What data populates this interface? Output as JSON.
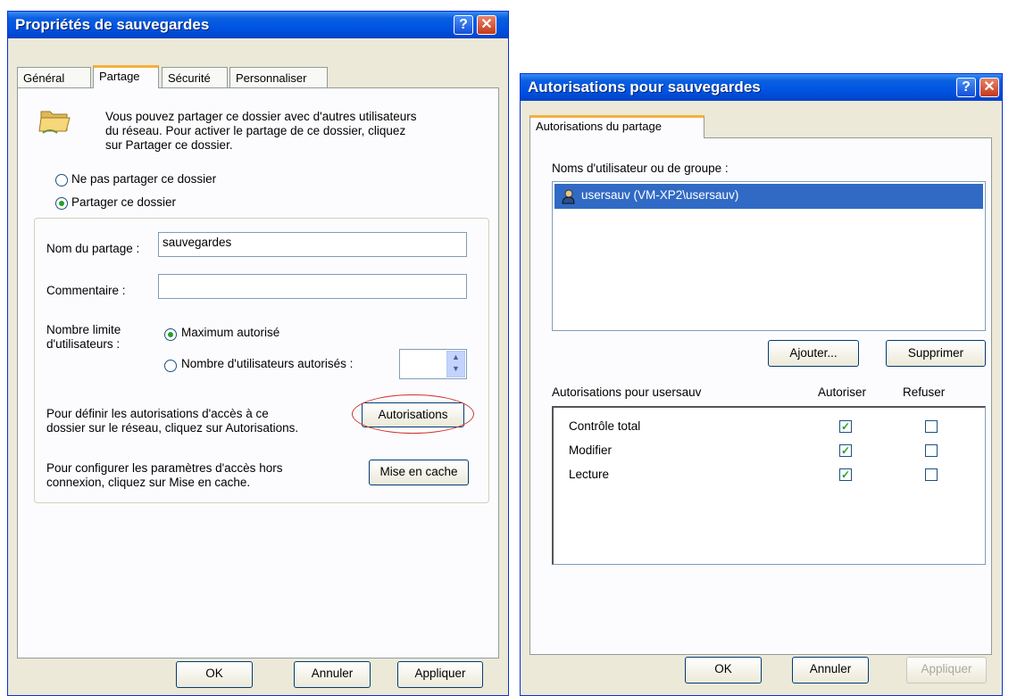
{
  "left_dialog": {
    "title": "Propriétés de sauvegardes",
    "help_glyph": "?",
    "close_glyph": "✕",
    "tabs": [
      "Général",
      "Partage",
      "Sécurité",
      "Personnaliser"
    ],
    "active_tab": "Partage",
    "intro": [
      "Vous pouvez partager ce dossier avec d'autres utilisateurs",
      "du réseau. Pour activer le partage de ce dossier, cliquez",
      "sur Partager ce dossier."
    ],
    "radio_no_share": "Ne pas partager ce dossier",
    "radio_share": "Partager ce dossier",
    "share_name_label": "Nom du partage :",
    "share_name_value": "sauvegardes",
    "comment_label": "Commentaire :",
    "comment_value": "",
    "user_limit_label": [
      "Nombre limite",
      "d'utilisateurs :"
    ],
    "radio_max": "Maximum autorisé",
    "radio_count": "Nombre d'utilisateurs autorisés :",
    "spin_value": "",
    "permissions_text": [
      "Pour définir les autorisations d'accès à ce",
      "dossier sur le réseau, cliquez sur Autorisations."
    ],
    "permissions_button": "Autorisations",
    "cache_text": [
      "Pour configurer les paramètres d'accès hors",
      "connexion, cliquez sur Mise en cache."
    ],
    "cache_button": "Mise en cache",
    "ok": "OK",
    "cancel": "Annuler",
    "apply": "Appliquer"
  },
  "right_dialog": {
    "title": "Autorisations pour sauvegardes",
    "help_glyph": "?",
    "close_glyph": "✕",
    "tab": "Autorisations du partage",
    "users_label": "Noms d'utilisateur ou de groupe :",
    "users": [
      {
        "name": "usersauv (VM-XP2\\usersauv)",
        "selected": true
      }
    ],
    "add_button": "Ajouter...",
    "remove_button": "Supprimer",
    "perm_header": "Autorisations pour usersauv",
    "allow_header": "Autoriser",
    "deny_header": "Refuser",
    "permissions": [
      {
        "name": "Contrôle total",
        "allow": true,
        "deny": false
      },
      {
        "name": "Modifier",
        "allow": true,
        "deny": false
      },
      {
        "name": "Lecture",
        "allow": true,
        "deny": false
      }
    ],
    "check_glyph": "✓",
    "ok": "OK",
    "cancel": "Annuler",
    "apply": "Appliquer"
  },
  "colors": {
    "selection": "#316ac5",
    "highlight_circle": "#d0302a",
    "xp_title": "#0054e3"
  }
}
